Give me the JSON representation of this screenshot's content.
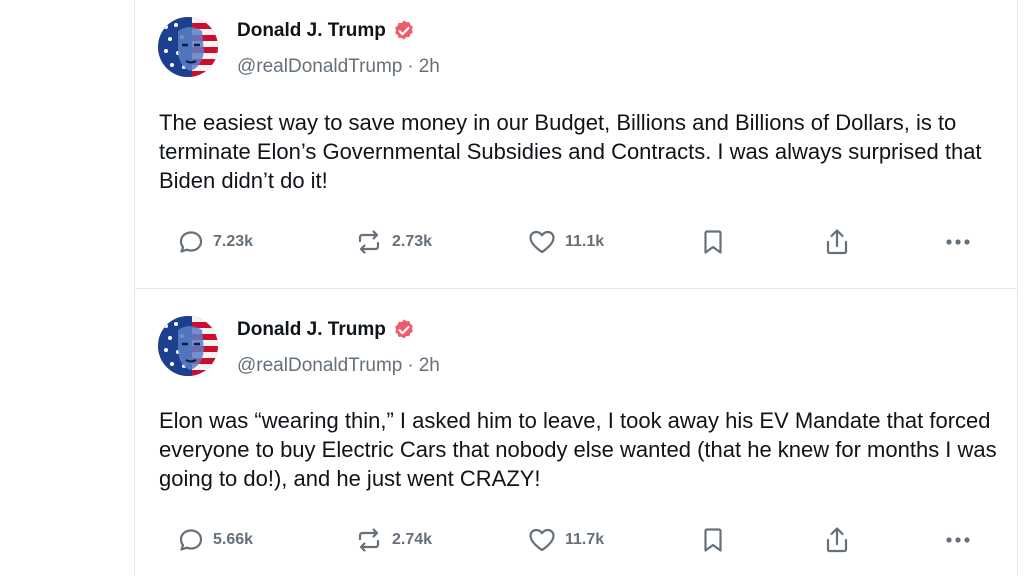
{
  "posts": [
    {
      "author": "Donald J. Trump",
      "handle": "@realDonaldTrump",
      "separator": "·",
      "time": "2h",
      "text": "The easiest way to save money in our Budget, Billions and Billions of Dollars, is to terminate Elon’s Governmental Subsidies and Contracts. I was always surprised that Biden didn’t do it!",
      "replies": "7.23k",
      "reposts": "2.73k",
      "likes": "11.1k"
    },
    {
      "author": "Donald J. Trump",
      "handle": "@realDonaldTrump",
      "separator": "·",
      "time": "2h",
      "text": "Elon was “wearing thin,” I asked him to leave, I took away his EV Mandate that forced everyone to buy Electric Cars that nobody else wanted (that he knew for months I was going to do!), and he just went CRAZY!",
      "replies": "5.66k",
      "reposts": "2.74k",
      "likes": "11.7k"
    }
  ],
  "colors": {
    "verified": "#f15a6b",
    "muted": "#66707a",
    "text": "#0f1419",
    "divider": "#e6e8ea"
  },
  "icons": [
    "reply-icon",
    "repost-icon",
    "like-icon",
    "bookmark-icon",
    "share-icon",
    "more-icon",
    "verified-badge-icon"
  ]
}
